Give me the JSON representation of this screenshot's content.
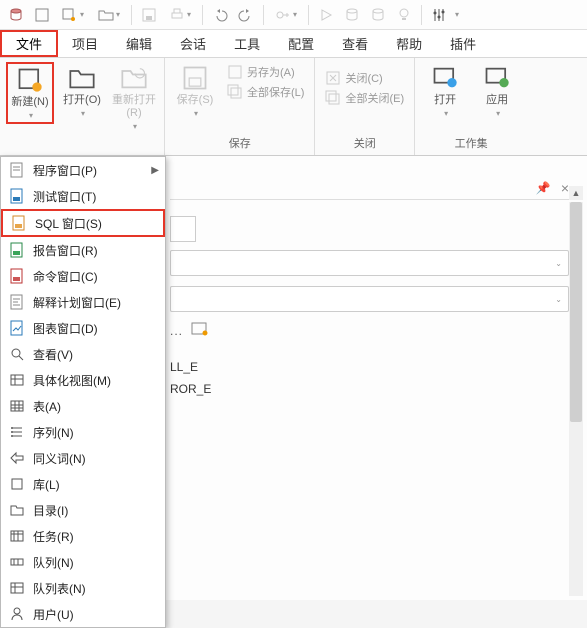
{
  "quickbar": {
    "icons": [
      "db",
      "rect",
      "rect-drop",
      "folder-drop",
      "save",
      "print-drop",
      "undo",
      "redo",
      "key-drop",
      "play",
      "cyl",
      "cyl2",
      "bulb",
      "sliders"
    ]
  },
  "menubar": {
    "items": [
      "文件",
      "项目",
      "编辑",
      "会话",
      "工具",
      "配置",
      "查看",
      "帮助",
      "插件"
    ],
    "active_index": 0
  },
  "ribbon": {
    "groups": [
      {
        "label": "",
        "big": [
          {
            "id": "new",
            "label": "新建(N)",
            "highlight": true,
            "drop": true
          },
          {
            "id": "open",
            "label": "打开(O)",
            "drop": true
          },
          {
            "id": "reopen",
            "label": "重新打开(R)",
            "dim": true,
            "drop": true
          }
        ]
      },
      {
        "label": "保存",
        "big": [
          {
            "id": "save",
            "label": "保存(S)",
            "dim": true,
            "drop": true
          }
        ],
        "small": [
          {
            "id": "saveas",
            "label": "另存为(A)",
            "dim": true
          },
          {
            "id": "saveall",
            "label": "全部保存(L)",
            "dim": true
          }
        ]
      },
      {
        "label": "关闭",
        "small": [
          {
            "id": "close",
            "label": "关闭(C)",
            "dim": true
          },
          {
            "id": "closeall",
            "label": "全部关闭(E)",
            "dim": true
          }
        ]
      },
      {
        "label": "工作集",
        "big": [
          {
            "id": "ws-open",
            "label": "打开",
            "drop": true
          },
          {
            "id": "ws-apply",
            "label": "应用",
            "drop": true
          }
        ]
      }
    ]
  },
  "contextmenu": {
    "items": [
      {
        "label": "程序窗口(P)",
        "icon": "doc",
        "sub": true
      },
      {
        "label": "测试窗口(T)",
        "icon": "doc-blue"
      },
      {
        "label": "SQL 窗口(S)",
        "icon": "doc-orange",
        "hl": true
      },
      {
        "label": "报告窗口(R)",
        "icon": "doc-green"
      },
      {
        "label": "命令窗口(C)",
        "icon": "doc-red"
      },
      {
        "label": "解释计划窗口(E)",
        "icon": "doc-gray"
      },
      {
        "label": "图表窗口(D)",
        "icon": "doc-blue"
      },
      {
        "label": "查看(V)",
        "icon": "search"
      },
      {
        "label": "具体化视图(M)",
        "icon": "table"
      },
      {
        "label": "表(A)",
        "icon": "grid"
      },
      {
        "label": "序列(N)",
        "icon": "seq"
      },
      {
        "label": "同义词(N)",
        "icon": "tag"
      },
      {
        "label": "库(L)",
        "icon": "lib"
      },
      {
        "label": "目录(I)",
        "icon": "dir"
      },
      {
        "label": "任务(R)",
        "icon": "task"
      },
      {
        "label": "队列(N)",
        "icon": "queue"
      },
      {
        "label": "队列表(N)",
        "icon": "queuet"
      },
      {
        "label": "用户(U)",
        "icon": "user"
      }
    ]
  },
  "main": {
    "pin": "pin",
    "close": "×",
    "list_fragments": [
      "LL_E",
      "ROR_E"
    ]
  },
  "colors": {
    "highlight": "#e53528"
  }
}
